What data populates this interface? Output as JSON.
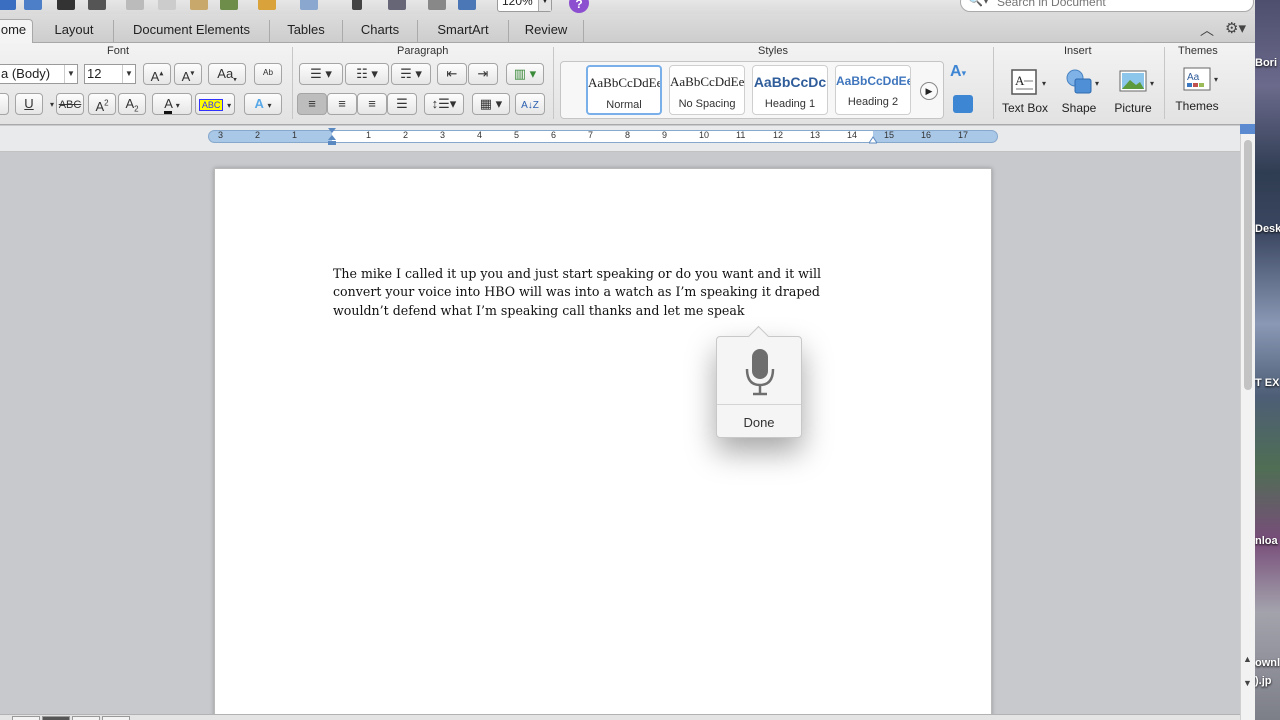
{
  "toolbar": {
    "zoom": "120%",
    "search_placeholder": "Search in Document"
  },
  "tabs": [
    "ome",
    "Layout",
    "Document Elements",
    "Tables",
    "Charts",
    "SmartArt",
    "Review"
  ],
  "ribbon": {
    "font_group_title": "Font",
    "paragraph_group_title": "Paragraph",
    "styles_group_title": "Styles",
    "insert_group_title": "Insert",
    "themes_group_title": "Themes",
    "font_name": "a (Body)",
    "font_size": "12",
    "styles": [
      {
        "preview": "AaBbCcDdEe",
        "name": "Normal"
      },
      {
        "preview": "AaBbCcDdEe",
        "name": "No Spacing"
      },
      {
        "preview": "AaBbCcDc",
        "name": "Heading 1"
      },
      {
        "preview": "AaBbCcDdEe",
        "name": "Heading 2"
      }
    ],
    "insert_items": [
      "Text Box",
      "Shape",
      "Picture"
    ],
    "themes_label": "Themes"
  },
  "ruler": {
    "numbers": [
      "3",
      "2",
      "1",
      "1",
      "2",
      "3",
      "4",
      "5",
      "6",
      "7",
      "8",
      "9",
      "10",
      "11",
      "12",
      "13",
      "14",
      "15",
      "16",
      "17"
    ]
  },
  "document": {
    "paragraph": "The mike I called it up you and just start speaking or do you want and it will convert your voice into HBO will was into a watch as I’m speaking it draped wouldn’t defend what I’m speaking call thanks and let me speak"
  },
  "dictation": {
    "done_label": "Done"
  },
  "desktop": {
    "labels": [
      "Bori",
      "Desk",
      "T EX",
      "nloa",
      "ownl",
      ").jp"
    ]
  }
}
